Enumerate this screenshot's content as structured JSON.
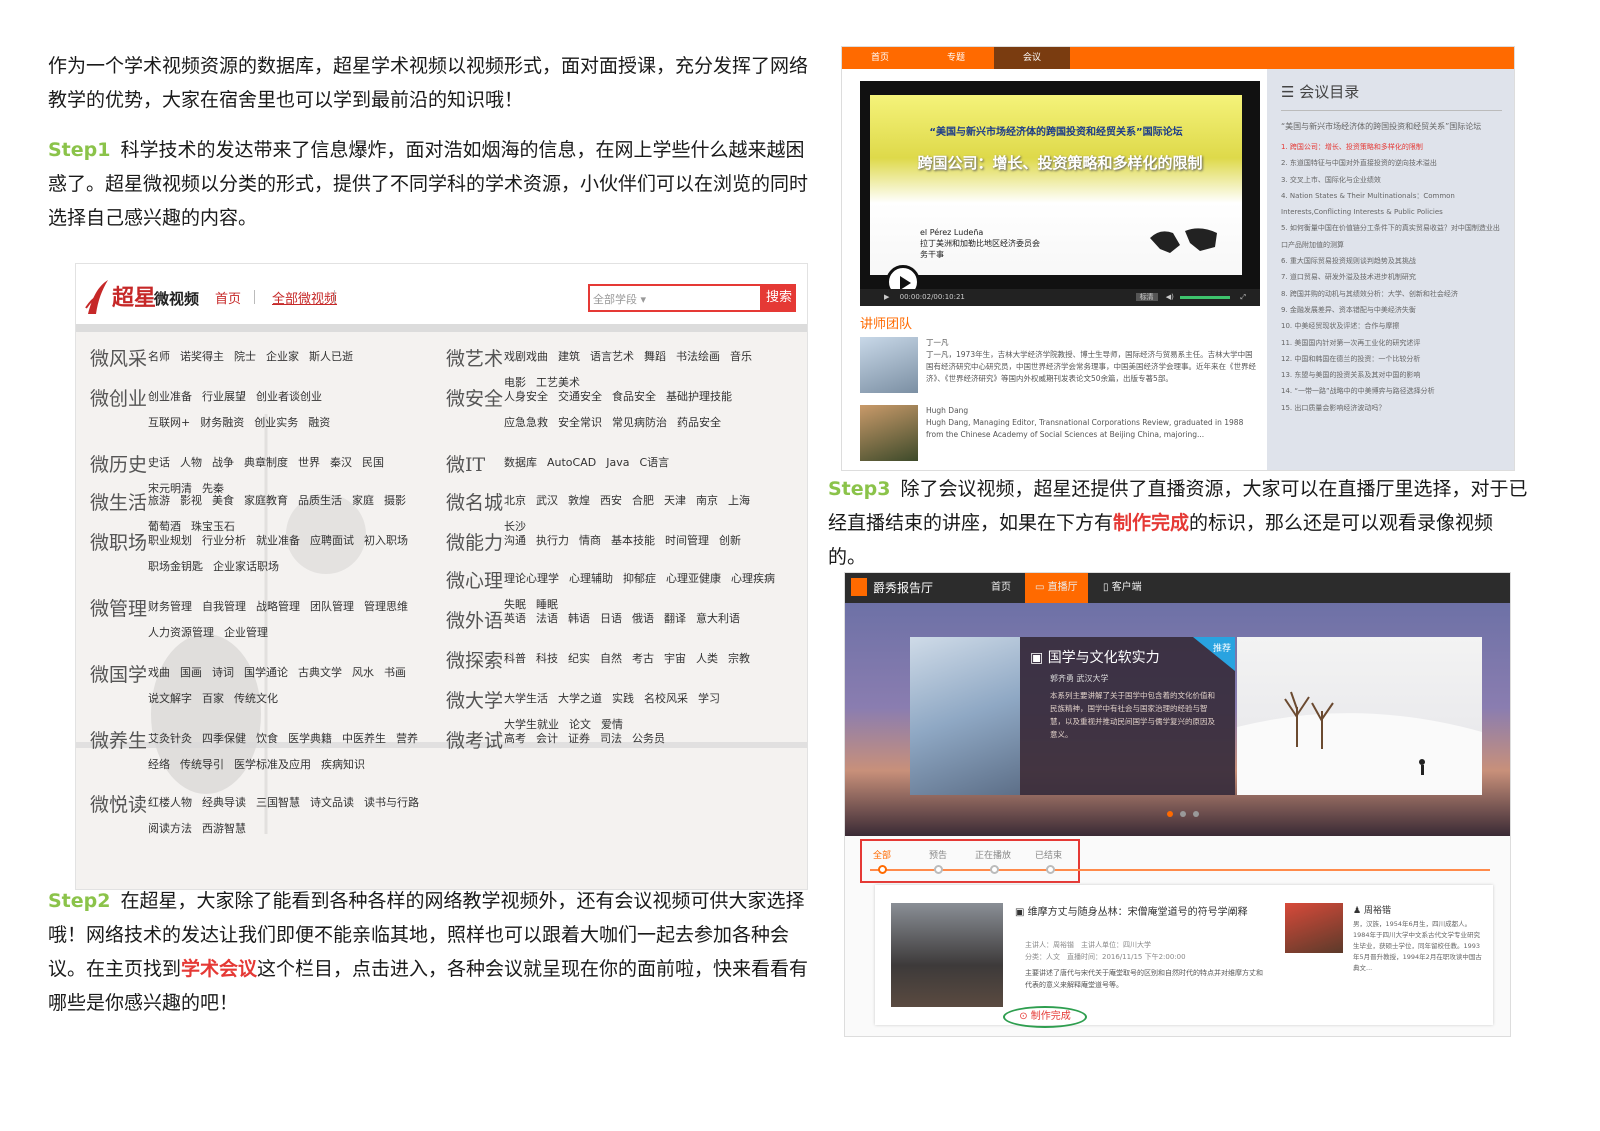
{
  "intro": "作为一个学术视频资源的数据库，超星学术视频以视频形式，面对面授课，充分发挥了网络教学的优势，大家在宿舍里也可以学到最前沿的知识哦！",
  "step1": {
    "label": "Step1",
    "text": "科学技术的发达带来了信息爆炸，面对浩如烟海的信息，在网上学些什么越来越困惑了。超星微视频以分类的形式，提供了不同学科的学术资源，小伙伴们可以在浏览的同时选择自己感兴趣的内容。"
  },
  "step2": {
    "label": "Step2",
    "text_before": "在超星，大家除了能看到各种各样的网络教学视频外，还有会议视频可供大家选择哦！网络技术的发达让我们即便不能亲临其地，照样也可以跟着大咖们一起去参加各种会议。在主页找到",
    "highlight": "学术会议",
    "text_after": "这个栏目，点击进入，各种会议就呈现在你的面前啦，快来看看有哪些是你感兴趣的吧！"
  },
  "step3": {
    "label": "Step3",
    "text_before": "除了会议视频，超星还提供了直播资源，大家可以在直播厅里选择，对于已经直播结束的讲座，如果在下方有",
    "highlight": "制作完成",
    "text_after": "的标识，那么还是可以观看录像视频的。"
  },
  "shot1": {
    "logo_text": "超星",
    "logo_sub": "微视频",
    "nav_home": "首页",
    "nav_all": "全部微视频",
    "search_placeholder": "全部学段",
    "search_button": "搜索",
    "left_categories": [
      {
        "name": "微风采",
        "items": [
          "名师",
          "诺奖得主",
          "院士",
          "企业家",
          "斯人已逝"
        ]
      },
      {
        "name": "微创业",
        "items": [
          "创业准备",
          "行业展望",
          "创业者谈创业",
          "互联网+",
          "财务融资",
          "创业实务",
          "融资"
        ]
      },
      {
        "name": "微历史",
        "items": [
          "史话",
          "人物",
          "战争",
          "典章制度",
          "世界",
          "秦汉",
          "民国",
          "宋元明清",
          "先秦"
        ]
      },
      {
        "name": "微生活",
        "items": [
          "旅游",
          "影视",
          "美食",
          "家庭教育",
          "品质生活",
          "家庭",
          "摄影",
          "葡萄酒",
          "珠宝玉石"
        ]
      },
      {
        "name": "微职场",
        "items": [
          "职业规划",
          "行业分析",
          "就业准备",
          "应聘面试",
          "初入职场",
          "职场金钥匙",
          "企业家话职场"
        ]
      },
      {
        "name": "微管理",
        "items": [
          "财务管理",
          "自我管理",
          "战略管理",
          "团队管理",
          "管理思维",
          "人力资源管理",
          "企业管理"
        ]
      },
      {
        "name": "微国学",
        "items": [
          "戏曲",
          "国画",
          "诗词",
          "国学通论",
          "古典文学",
          "风水",
          "书画",
          "说文解字",
          "百家",
          "传统文化"
        ]
      },
      {
        "name": "微养生",
        "items": [
          "艾灸针灸",
          "四季保健",
          "饮食",
          "医学典籍",
          "中医养生",
          "营养",
          "经络",
          "传统导引",
          "医学标准及应用",
          "疾病知识"
        ]
      },
      {
        "name": "微悦读",
        "items": [
          "红楼人物",
          "经典导读",
          "三国智慧",
          "诗文品读",
          "读书与行路",
          "阅读方法",
          "西游智慧"
        ]
      }
    ],
    "right_categories": [
      {
        "name": "微艺术",
        "items": [
          "戏剧戏曲",
          "建筑",
          "语言艺术",
          "舞蹈",
          "书法绘画",
          "音乐",
          "电影",
          "工艺美术"
        ]
      },
      {
        "name": "微安全",
        "items": [
          "人身安全",
          "交通安全",
          "食品安全",
          "基础护理技能",
          "应急急救",
          "安全常识",
          "常见病防治",
          "药品安全"
        ]
      },
      {
        "name": "微IT",
        "items": [
          "数据库",
          "AutoCAD",
          "Java",
          "C语言"
        ]
      },
      {
        "name": "微名城",
        "items": [
          "北京",
          "武汉",
          "敦煌",
          "西安",
          "合肥",
          "天津",
          "南京",
          "上海",
          "长沙"
        ]
      },
      {
        "name": "微能力",
        "items": [
          "沟通",
          "执行力",
          "情商",
          "基本技能",
          "时间管理",
          "创新"
        ]
      },
      {
        "name": "微心理",
        "items": [
          "理论心理学",
          "心理辅助",
          "抑郁症",
          "心理亚健康",
          "心理疾病",
          "失眠",
          "睡眠"
        ]
      },
      {
        "name": "微外语",
        "items": [
          "英语",
          "法语",
          "韩语",
          "日语",
          "俄语",
          "翻译",
          "意大利语"
        ]
      },
      {
        "name": "微探索",
        "items": [
          "科普",
          "科技",
          "纪实",
          "自然",
          "考古",
          "宇宙",
          "人类",
          "宗教"
        ]
      },
      {
        "name": "微大学",
        "items": [
          "大学生活",
          "大学之道",
          "实践",
          "名校风采",
          "学习",
          "大学生就业",
          "论文",
          "爱情"
        ]
      },
      {
        "name": "微考试",
        "items": [
          "高考",
          "会计",
          "证券",
          "司法",
          "公务员"
        ]
      }
    ]
  },
  "shot2": {
    "tabs": [
      "首页",
      "专题",
      "会议"
    ],
    "slide_title": "“美国与新兴市场经济体的跨国投资和经贸关系”国际论坛",
    "slide_main": "跨国公司：增长、投资策略和多样化的限制",
    "slide_person": "el Pérez Ludeña\n拉丁美洲和加勒比地区经济委员会\n务干事",
    "time": "00:00:02/00:10:21",
    "quality": "标清",
    "lecturer_title": "讲师团队",
    "lecturers": [
      {
        "name": "丁一凡",
        "bio": "丁一凡，1973年生，吉林大学经济学院教授、博士生导师，国际经济与贸易系主任。吉林大学中国国有经济研究中心研究员，中国世界经济学会常务理事，中国美国经济学会理事。近年来在《世界经济》、《世界经济研究》等国内外权威期刊发表论文50余篇，出版专著5部。"
      },
      {
        "name": "Hugh Dang",
        "bio": "Hugh Dang, Managing Editor, Transnational Corporations Review, graduated in 1988 from the Chinese Academy of Social Sciences at Beijing China, majoring..."
      }
    ],
    "catalog_title": "会议目录",
    "catalog_intro": "“美国与新兴市场经济体的跨国投资和经贸关系”国际论坛",
    "catalog_items": [
      "1. 跨国公司：增长、投资策略和多样化的限制",
      "2. 东道国特征与中国对外直接投资的逆向技术溢出",
      "3. 交叉上市、国际化与企业绩效",
      "4. Nation States & Their Multinationals：Common Interests,Conflicting Interests & Public Policies",
      "5. 如何衡量中国在价值链分工条件下的真实贸易收益？对中国制造业出口产品附加值的测算",
      "6. 重大国际贸易投资规则谈判趋势及其挑战",
      "7. 道口贸易、研发外溢及技术进步机制研究",
      "8. 跨国并购的动机与其绩效分析：大学、创新和社会经济",
      "9. 金融发展差异、资本错配与中美经济失衡",
      "10. 中美经贸现状及评述：合作与摩擦",
      "11. 美国国内针对第一次再工业化的研究述评",
      "12. 中国和韩国在德兰的投资：一个比较分析",
      "13. 东盟与美国的投资关系及其对中国的影响",
      "14. “一带一路”战略中的中美博弈与路径选择分析",
      "15. 出口质量会影响经济波动吗？"
    ]
  },
  "shot3": {
    "brand": "爵秀报告厅",
    "nav": [
      "首页",
      "直播厅",
      "客户端"
    ],
    "banner_title": "国学与文化软实力",
    "banner_tag": "推荐",
    "banner_sub": "郭齐勇 武汉大学",
    "banner_desc": "本系列主要讲解了关于国学中包含着的文化价值和民族精神，国学中有社会与国家治理的经验与智慧，以及重视并推动民间国学与儒学复兴的原因及意义。",
    "filter_tabs": [
      "全部",
      "预告",
      "正在播放",
      "已结束"
    ],
    "item_title": "维摩方丈与随身丛林：宋僧庵堂道号的符号学阐释",
    "item_meta": "主讲人：周裕锴　主讲人单位：四川大学\n分类：人文　直播时间：2016/11/15 下午2:00:00",
    "item_desc": "主要讲述了唐代与宋代关于庵堂取号的区别和自然时代的特点并对维摩方丈和代表的意义来解释庵堂道号等。",
    "done_label": "制作完成",
    "speaker_name": "周裕锴",
    "speaker_bio": "男，汉族，1954年6月生，四川成都人。1984年于四川大学中文系古代文学专业研究生毕业，获硕士学位，同年留校任教。1993年5月晋升教授，1994年2月在职攻读中国古典文..."
  },
  "colors": {
    "accent_green": "#8bc34a",
    "highlight_red": "#e53935",
    "orange": "#ff6a00"
  }
}
